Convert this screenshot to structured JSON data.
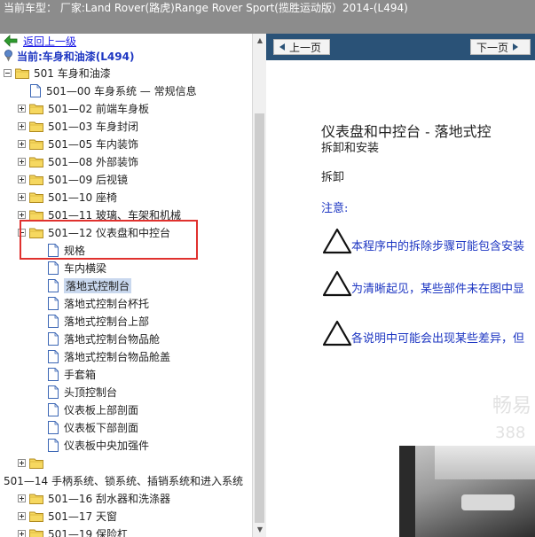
{
  "header": {
    "title": "当前车型： 厂家:Land Rover(路虎)Range Rover Sport(揽胜运动版）2014-(L494)"
  },
  "tree": {
    "back_label": "返回上一级",
    "current_label": "当前:车身和油漆(L494)",
    "items": [
      {
        "label": "501 车身和油漆",
        "type": "folder",
        "expander": "minus"
      },
      {
        "label": "501—00 车身系统 — 常规信息",
        "type": "doc",
        "expander": "none"
      },
      {
        "label": "501—02 前端车身板",
        "type": "folder",
        "expander": "plus"
      },
      {
        "label": "501—03 车身封闭",
        "type": "folder",
        "expander": "plus"
      },
      {
        "label": "501—05 车内装饰",
        "type": "folder",
        "expander": "plus"
      },
      {
        "label": "501—08 外部装饰",
        "type": "folder",
        "expander": "plus"
      },
      {
        "label": "501—09 后视镜",
        "type": "folder",
        "expander": "plus"
      },
      {
        "label": "501—10 座椅",
        "type": "folder",
        "expander": "plus"
      },
      {
        "label": "501—11 玻璃、车架和机械",
        "type": "folder",
        "expander": "plus"
      },
      {
        "label": "501—12 仪表盘和中控台",
        "type": "folder",
        "expander": "minus"
      },
      {
        "label": "规格",
        "type": "doc",
        "expander": "none"
      },
      {
        "label": "车内横梁",
        "type": "doc",
        "expander": "none"
      },
      {
        "label": "落地式控制台",
        "type": "doc",
        "expander": "none",
        "selected": true
      },
      {
        "label": "落地式控制台杯托",
        "type": "doc",
        "expander": "none"
      },
      {
        "label": "落地式控制台上部",
        "type": "doc",
        "expander": "none"
      },
      {
        "label": "落地式控制台物品舱",
        "type": "doc",
        "expander": "none"
      },
      {
        "label": "落地式控制台物品舱盖",
        "type": "doc",
        "expander": "none"
      },
      {
        "label": "手套箱",
        "type": "doc",
        "expander": "none"
      },
      {
        "label": "头顶控制台",
        "type": "doc",
        "expander": "none"
      },
      {
        "label": "仪表板上部剖面",
        "type": "doc",
        "expander": "none"
      },
      {
        "label": "仪表板下部剖面",
        "type": "doc",
        "expander": "none"
      },
      {
        "label": "仪表板中央加强件",
        "type": "doc",
        "expander": "none"
      },
      {
        "label": "",
        "type": "folder",
        "expander": "plus"
      },
      {
        "label": "501—14 手柄系统、锁系统、插销系统和进入系统",
        "type": "text",
        "expander": "none"
      },
      {
        "label": "501—16 刮水器和洗涤器",
        "type": "folder",
        "expander": "plus"
      },
      {
        "label": "501—17 天窗",
        "type": "folder",
        "expander": "plus"
      },
      {
        "label": "501—19 保险杠",
        "type": "folder",
        "expander": "plus"
      }
    ]
  },
  "document": {
    "prev_label": "上一页",
    "next_label": "下一页",
    "title": "仪表盘和中控台 - 落地式控",
    "subtitle": "拆卸和安装",
    "section": "拆卸",
    "note_label": "注意:",
    "warnings": [
      "本程序中的拆除步骤可能包含安装",
      "为清晰起见，某些部件未在图中显",
      "各说明中可能会出现某些差异，但"
    ],
    "watermark_1": "畅易",
    "watermark_2": "388"
  },
  "colors": {
    "header_bg": "#8c8c8c",
    "nav_bg": "#2a5277",
    "link": "#1a1ae6",
    "doc_blue": "#1d36c2",
    "highlight_box": "#e0312e",
    "selection": "#c9d8ee"
  }
}
